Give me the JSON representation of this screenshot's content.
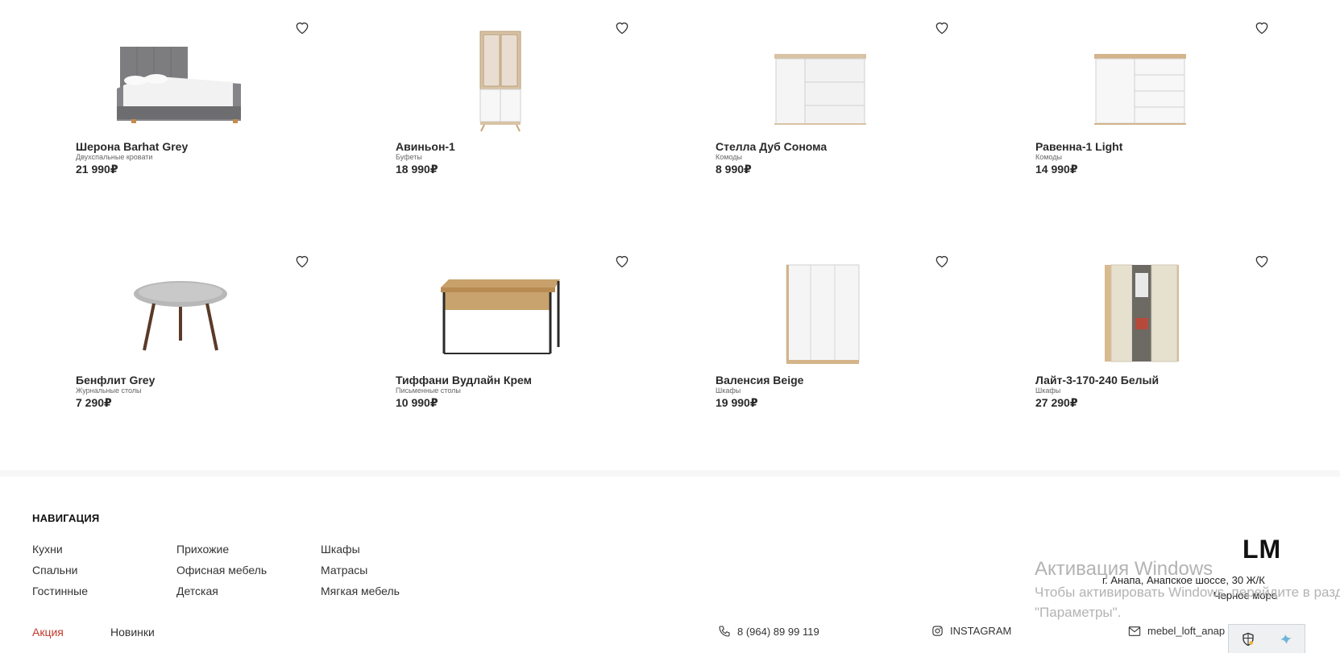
{
  "products": [
    {
      "name": "Шерона Barhat Grey",
      "category": "Двухспальные кровати",
      "price": "21 990₽",
      "icon": "bed-image"
    },
    {
      "name": "Авиньон-1",
      "category": "Буфеты",
      "price": "18 990₽",
      "icon": "cabinet-image"
    },
    {
      "name": "Стелла Дуб Сонома",
      "category": "Комоды",
      "price": "8 990₽",
      "icon": "dresser-image"
    },
    {
      "name": "Равенна-1 Light",
      "category": "Комоды",
      "price": "14 990₽",
      "icon": "dresser-image"
    },
    {
      "name": "Бенфлит Grey",
      "category": "Журнальные столы",
      "price": "7 290₽",
      "icon": "coffee-table-image"
    },
    {
      "name": "Тиффани Вудлайн Крем",
      "category": "Письменные столы",
      "price": "10 990₽",
      "icon": "desk-image"
    },
    {
      "name": "Валенсия Beige",
      "category": "Шкафы",
      "price": "19 990₽",
      "icon": "wardrobe-image"
    },
    {
      "name": "Лайт-3-170-240 Белый",
      "category": "Шкафы",
      "price": "27 290₽",
      "icon": "mirror-wardrobe-image"
    }
  ],
  "footer": {
    "nav_title": "НАВИГАЦИЯ",
    "nav_columns": [
      [
        "Кухни",
        "Спальни",
        "Гостинные"
      ],
      [
        "Прихожие",
        "Офисная мебель",
        "Детская"
      ],
      [
        "Шкафы",
        "Матрасы",
        "Мягкая мебель"
      ]
    ],
    "promo_link": "Акция",
    "new_link": "Новинки",
    "logo": "LM",
    "address_line1": "г. Анапа, Анапское шоссе, 30 Ж/К",
    "address_line2": "Черное море",
    "phone": "8 (964) 89 99 119",
    "instagram": "INSTAGRAM",
    "email": "mebel_loft_anap"
  },
  "windows_overlay": {
    "title": "Активация Windows",
    "line1": "Чтобы активировать Windows, перейдите в раздел",
    "line2": "\"Параметры\"."
  },
  "colors": {
    "promo": "#c0392b",
    "text": "#222222",
    "muted": "#666666",
    "watermark": "#b3b3b3"
  }
}
